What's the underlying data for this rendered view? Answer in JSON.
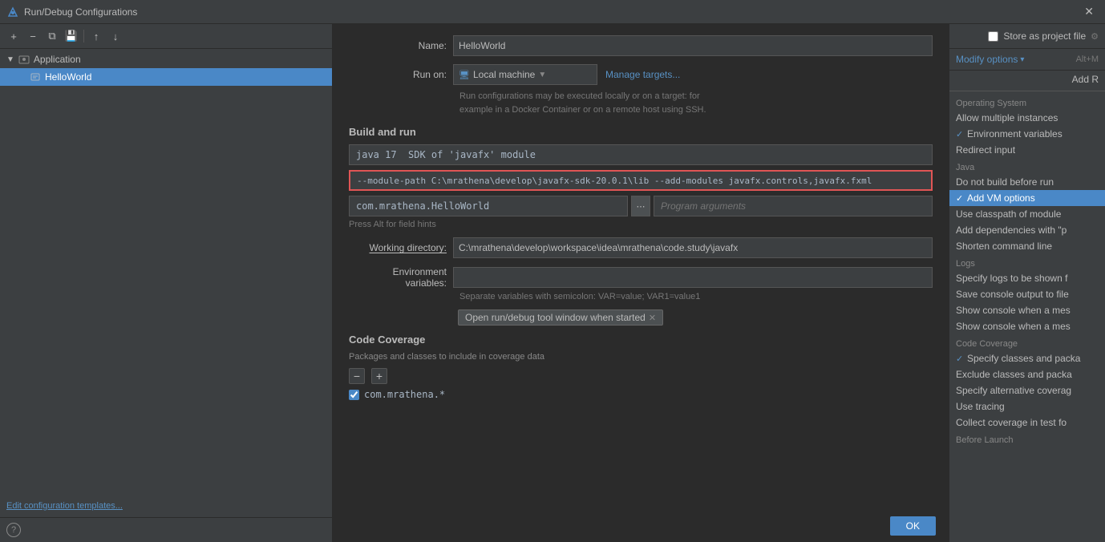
{
  "titleBar": {
    "title": "Run/Debug Configurations",
    "closeLabel": "✕"
  },
  "toolbar": {
    "addBtn": "+",
    "removeBtn": "−",
    "copyBtn": "⧉",
    "saveBtn": "💾",
    "moveUpBtn": "↑",
    "moveDownBtn": "↓"
  },
  "tree": {
    "parentLabel": "Application",
    "childLabel": "HelloWorld"
  },
  "bottomLink": "Edit configuration templates...",
  "helpIcon": "?",
  "form": {
    "nameLabel": "Name:",
    "nameValue": "HelloWorld",
    "runOnLabel": "Run on:",
    "runOnValue": "Local machine",
    "runOnHint1": "Run configurations may be executed locally or on a target: for",
    "runOnHint2": "example in a Docker Container or on a remote host using SSH.",
    "manageTargets": "Manage targets...",
    "buildRunTitle": "Build and run",
    "modifyOptionsLabel": "Modify options",
    "modifyOptionsShortcut": "Alt+M",
    "addRLabel": "Add R",
    "sdkValue": "java 17  SDK of 'javafx' module",
    "vmOptionsValue": "--module-path C:\\mrathena\\develop\\javafx-sdk-20.0.1\\lib --add-modules javafx.controls,javafx.fxml",
    "mainClassValue": "com.mrathena.HelloWorld",
    "programArgsPlaceholder": "Program arguments",
    "fieldHintsHint": "Press Alt for field hints",
    "workingDirLabel": "Working directory:",
    "workingDirValue": "C:\\mrathena\\develop\\workspace\\idea\\mrathena\\code.study\\javafx",
    "envVarsLabel": "Environment variables:",
    "envVarsSeparatorHint": "Separate variables with semicolon: VAR=value; VAR1=value1",
    "openToolWindowTag": "Open run/debug tool window when started",
    "codeCoverageTitle": "Code Coverage",
    "ccSubtitle": "Packages and classes to include in coverage data",
    "ccCheckboxLabel": "com.mrathena.*",
    "okBtn": "OK"
  },
  "rightPanel": {
    "modifyOptions": "Modify options",
    "shortcut": "Alt+M",
    "addR": "Add R",
    "sections": [
      {
        "label": "Operating System",
        "items": [
          {
            "label": "Allow multiple instances",
            "checked": false,
            "active": false
          },
          {
            "label": "Environment variables",
            "checked": true,
            "active": false
          },
          {
            "label": "Redirect input",
            "checked": false,
            "active": false
          }
        ]
      },
      {
        "label": "Java",
        "items": [
          {
            "label": "Do not build before run",
            "checked": false,
            "active": false
          },
          {
            "label": "Add VM options",
            "checked": true,
            "active": true
          },
          {
            "label": "Use classpath of module",
            "checked": false,
            "active": false
          },
          {
            "label": "Add dependencies with \"p",
            "checked": false,
            "active": false
          },
          {
            "label": "Shorten command line",
            "checked": false,
            "active": false
          }
        ]
      },
      {
        "label": "Logs",
        "items": [
          {
            "label": "Specify logs to be shown f",
            "checked": false,
            "active": false
          },
          {
            "label": "Save console output to file",
            "checked": false,
            "active": false
          },
          {
            "label": "Show console when a mes",
            "checked": false,
            "active": false
          },
          {
            "label": "Show console when a mes",
            "checked": false,
            "active": false
          }
        ]
      },
      {
        "label": "Code Coverage",
        "items": [
          {
            "label": "Specify classes and packa",
            "checked": true,
            "active": false
          },
          {
            "label": "Exclude classes and packa",
            "checked": false,
            "active": false
          },
          {
            "label": "Specify alternative coverag",
            "checked": false,
            "active": false
          },
          {
            "label": "Use tracing",
            "checked": false,
            "active": false
          },
          {
            "label": "Collect coverage in test fo",
            "checked": false,
            "active": false
          }
        ]
      },
      {
        "label": "Before Launch",
        "items": []
      }
    ]
  }
}
